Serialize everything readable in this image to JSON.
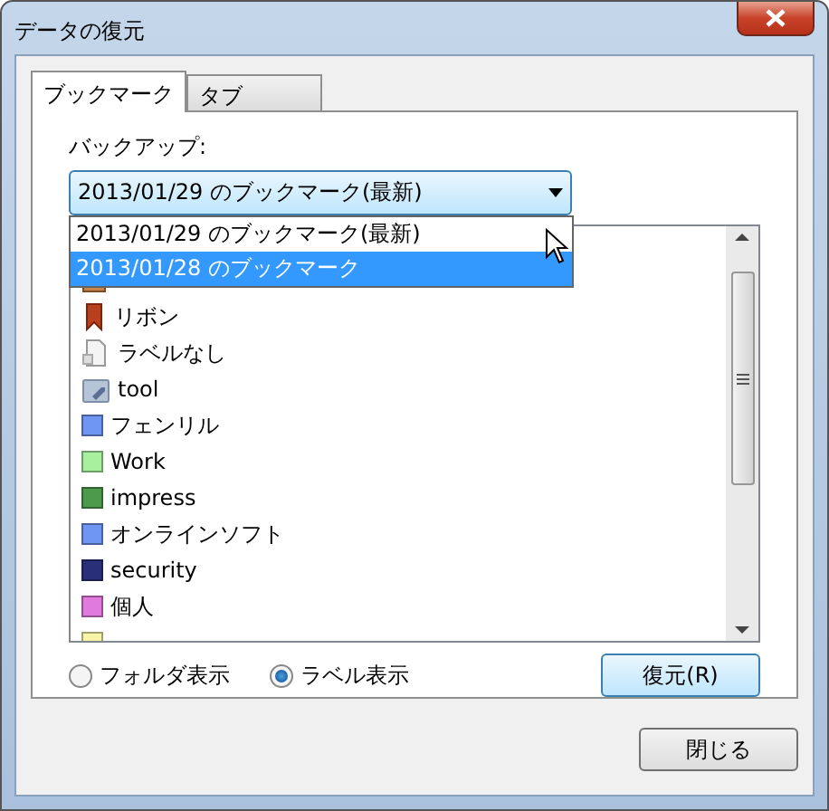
{
  "window": {
    "title": "データの復元"
  },
  "tabs": [
    {
      "label": "ブックマーク",
      "selected": true
    },
    {
      "label": "タブ",
      "selected": false
    }
  ],
  "backup": {
    "label": "バックアップ:",
    "value": "2013/01/29 のブックマーク(最新)",
    "expanded": true,
    "options": [
      {
        "label": "2013/01/29 のブックマーク(最新)",
        "highlighted": false
      },
      {
        "label": "2013/01/28 のブックマーク",
        "highlighted": true
      }
    ]
  },
  "labels": [
    {
      "kind": "box"
    },
    {
      "kind": "ribbon",
      "label": "リボン"
    },
    {
      "kind": "page",
      "label": "ラベルなし"
    },
    {
      "kind": "tag",
      "label": "tool"
    },
    {
      "kind": "swatch",
      "label": "フェンリル",
      "color": "#6f96f0"
    },
    {
      "kind": "swatch",
      "label": "Work",
      "color": "#a8f0a0"
    },
    {
      "kind": "swatch",
      "label": "impress",
      "color": "#4c9a4c"
    },
    {
      "kind": "swatch",
      "label": "オンラインソフト",
      "color": "#6f96f0"
    },
    {
      "kind": "swatch",
      "label": "security",
      "color": "#2a2f7a"
    },
    {
      "kind": "swatch",
      "label": "個人",
      "color": "#e07adc"
    },
    {
      "kind": "swatch",
      "color": "#f8f4a8"
    }
  ],
  "view_options": [
    {
      "label": "フォルダ表示",
      "selected": false
    },
    {
      "label": "ラベル表示",
      "selected": true
    }
  ],
  "restore_button": "復元(R)",
  "close_button": "閉じる"
}
